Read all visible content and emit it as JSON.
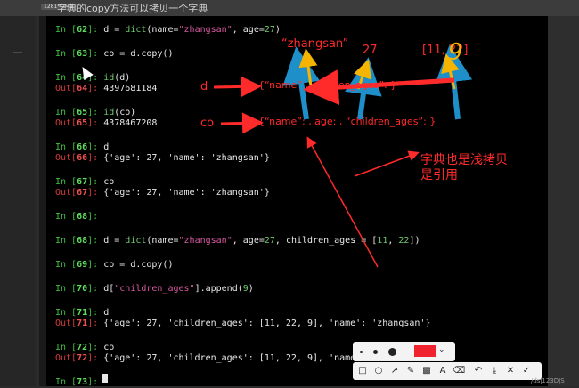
{
  "app": {
    "caption": "字典的copy方法可以拷贝一个字典",
    "dims_badge": "1281 * 941",
    "watermark": "/dsj123DJS"
  },
  "lines": [
    {
      "kind": "in",
      "n": "62",
      "code": [
        {
          "t": "d = ",
          "c": ""
        },
        {
          "t": "dict",
          "c": "fn"
        },
        {
          "t": "(name=",
          "c": ""
        },
        {
          "t": "\"zhangsan\"",
          "c": "str"
        },
        {
          "t": ", age=",
          "c": ""
        },
        {
          "t": "27",
          "c": "num"
        },
        {
          "t": ")",
          "c": ""
        }
      ]
    },
    {
      "kind": "in",
      "n": "63",
      "code": [
        {
          "t": "co = d.copy()",
          "c": ""
        }
      ]
    },
    {
      "kind": "in",
      "n": "64",
      "code": [
        {
          "t": "id",
          "c": "fn"
        },
        {
          "t": "(d)",
          "c": ""
        }
      ]
    },
    {
      "kind": "out",
      "n": "64",
      "code": [
        {
          "t": "4397681184",
          "c": ""
        }
      ]
    },
    {
      "kind": "in",
      "n": "65",
      "code": [
        {
          "t": "id",
          "c": "fn"
        },
        {
          "t": "(co)",
          "c": ""
        }
      ]
    },
    {
      "kind": "out",
      "n": "65",
      "code": [
        {
          "t": "4378467208",
          "c": ""
        }
      ]
    },
    {
      "kind": "in",
      "n": "66",
      "code": [
        {
          "t": "d",
          "c": ""
        }
      ]
    },
    {
      "kind": "out",
      "n": "66",
      "code": [
        {
          "t": "{'age': 27, 'name': 'zhangsan'}",
          "c": ""
        }
      ]
    },
    {
      "kind": "in",
      "n": "67",
      "code": [
        {
          "t": "co",
          "c": ""
        }
      ]
    },
    {
      "kind": "out",
      "n": "67",
      "code": [
        {
          "t": "{'age': 27, 'name': 'zhangsan'}",
          "c": ""
        }
      ]
    },
    {
      "kind": "in",
      "n": "68",
      "code": []
    },
    {
      "kind": "in",
      "n": "68",
      "code": [
        {
          "t": "d = ",
          "c": ""
        },
        {
          "t": "dict",
          "c": "fn"
        },
        {
          "t": "(name=",
          "c": ""
        },
        {
          "t": "\"zhangsan\"",
          "c": "str"
        },
        {
          "t": ", age=",
          "c": ""
        },
        {
          "t": "27",
          "c": "num"
        },
        {
          "t": ", children_ages = [",
          "c": ""
        },
        {
          "t": "11",
          "c": "num"
        },
        {
          "t": ", ",
          "c": ""
        },
        {
          "t": "22",
          "c": "num"
        },
        {
          "t": "])",
          "c": ""
        }
      ]
    },
    {
      "kind": "in",
      "n": "69",
      "code": [
        {
          "t": "co = d.copy()",
          "c": ""
        }
      ]
    },
    {
      "kind": "in",
      "n": "70",
      "code": [
        {
          "t": "d[",
          "c": ""
        },
        {
          "t": "\"children_ages\"",
          "c": "str"
        },
        {
          "t": "].append(",
          "c": ""
        },
        {
          "t": "9",
          "c": "num"
        },
        {
          "t": ")",
          "c": ""
        }
      ]
    },
    {
      "kind": "in",
      "n": "71",
      "code": [
        {
          "t": "d",
          "c": ""
        }
      ]
    },
    {
      "kind": "out",
      "n": "71",
      "code": [
        {
          "t": "{'age': 27, 'children_ages': [11, 22, 9], 'name': 'zhangsan'}",
          "c": ""
        }
      ]
    },
    {
      "kind": "in",
      "n": "72",
      "code": [
        {
          "t": "co",
          "c": ""
        }
      ]
    },
    {
      "kind": "out",
      "n": "72",
      "code": [
        {
          "t": "{'age': 27, 'children_ages': [11, 22, 9], 'name':",
          "c": ""
        }
      ]
    },
    {
      "kind": "in",
      "n": "73",
      "code": []
    }
  ],
  "annotations": {
    "val_name": "“zhangsan”",
    "val_age": "27",
    "val_list": "[11, 22]",
    "val_nine": "9",
    "label_d": "d",
    "label_co": "co",
    "dict_d": "{“name”           ,           children_ages”:    }",
    "dict_co": "{“name”:       , age:     , “children_ages”:    }",
    "note_line1": "字典也是浅拷贝",
    "note_line2": "是引用"
  },
  "colors": {
    "prompt_in": "#3fbf3f",
    "prompt_out": "#d23a3a",
    "string": "#d65aa0",
    "annotation": "#ff2a2a",
    "pen": "#f0222e",
    "arrow_blue": "#1e8fc8",
    "highlight": "#f5b400"
  }
}
